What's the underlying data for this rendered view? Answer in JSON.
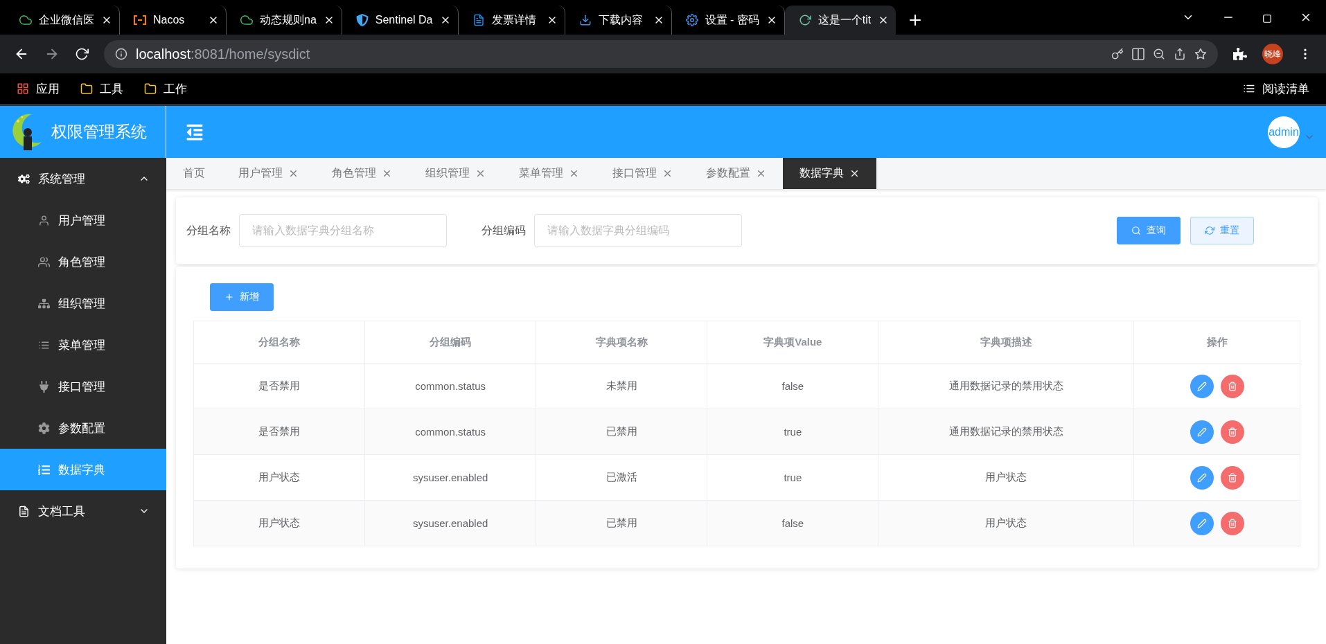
{
  "browser": {
    "tabs": [
      {
        "title": "企业微信医",
        "selected": false
      },
      {
        "title": "Nacos",
        "selected": false
      },
      {
        "title": "动态规则na",
        "selected": false
      },
      {
        "title": "Sentinel Da",
        "selected": false
      },
      {
        "title": "发票详情",
        "selected": false
      },
      {
        "title": "下载内容",
        "selected": false
      },
      {
        "title": "设置 - 密码",
        "selected": false
      },
      {
        "title": "这是一个tit",
        "selected": true
      }
    ],
    "address": {
      "host": "localhost",
      "path": ":8081/home/sysdict"
    },
    "profile": "晓峰",
    "bookmarks": [
      "应用",
      "工具",
      "工作"
    ],
    "reading_list": "阅读清单"
  },
  "app": {
    "title": "权限管理系统",
    "user": "admin",
    "sidebar": [
      {
        "label": "系统管理",
        "expanded": true,
        "selected": false,
        "children": [
          {
            "label": "用户管理",
            "selected": false
          },
          {
            "label": "角色管理",
            "selected": false
          },
          {
            "label": "组织管理",
            "selected": false
          },
          {
            "label": "菜单管理",
            "selected": false
          },
          {
            "label": "接口管理",
            "selected": false
          },
          {
            "label": "参数配置",
            "selected": false
          },
          {
            "label": "数据字典",
            "selected": true
          }
        ]
      },
      {
        "label": "文档工具",
        "expanded": false,
        "selected": false
      }
    ],
    "tabs": [
      {
        "label": "首页",
        "closable": false,
        "selected": false
      },
      {
        "label": "用户管理",
        "closable": true,
        "selected": false
      },
      {
        "label": "角色管理",
        "closable": true,
        "selected": false
      },
      {
        "label": "组织管理",
        "closable": true,
        "selected": false
      },
      {
        "label": "菜单管理",
        "closable": true,
        "selected": false
      },
      {
        "label": "接口管理",
        "closable": true,
        "selected": false
      },
      {
        "label": "参数配置",
        "closable": true,
        "selected": false
      },
      {
        "label": "数据字典",
        "closable": true,
        "selected": true
      }
    ],
    "filters": [
      {
        "label": "分组名称",
        "placeholder": "请输入数据字典分组名称"
      },
      {
        "label": "分组编码",
        "placeholder": "请输入数据字典分组编码"
      }
    ],
    "search_button": "查询",
    "reset_button": "重置",
    "add_button": "新增",
    "table": {
      "columns": [
        "分组名称",
        "分组编码",
        "字典项名称",
        "字典项Value",
        "字典项描述",
        "操作"
      ],
      "rows": [
        [
          "是否禁用",
          "common.status",
          "未禁用",
          "false",
          "通用数据记录的禁用状态"
        ],
        [
          "是否禁用",
          "common.status",
          "已禁用",
          "true",
          "通用数据记录的禁用状态"
        ],
        [
          "用户状态",
          "sysuser.enabled",
          "已激活",
          "true",
          "用户状态"
        ],
        [
          "用户状态",
          "sysuser.enabled",
          "已禁用",
          "false",
          "用户状态"
        ]
      ]
    }
  }
}
